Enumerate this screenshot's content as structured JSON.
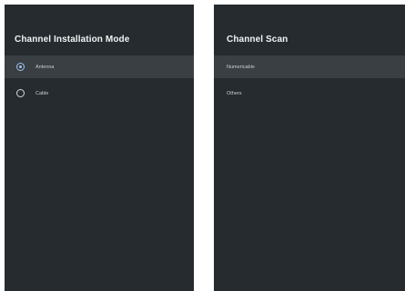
{
  "install_mode": {
    "title": "Channel Installation Mode",
    "options": [
      {
        "label": "Antenna",
        "selected": true
      },
      {
        "label": "Cable",
        "selected": false
      }
    ]
  },
  "channel_scan": {
    "title": "Channel Scan",
    "options": [
      {
        "label": "Numericable"
      },
      {
        "label": "Others"
      }
    ]
  },
  "colors": {
    "panel_background": "#262b2f",
    "highlight_row": "#3a3f44",
    "radio_selected": "#9cc3f0"
  },
  "icons": [
    "radio-selected-icon",
    "radio-unselected-icon"
  ]
}
